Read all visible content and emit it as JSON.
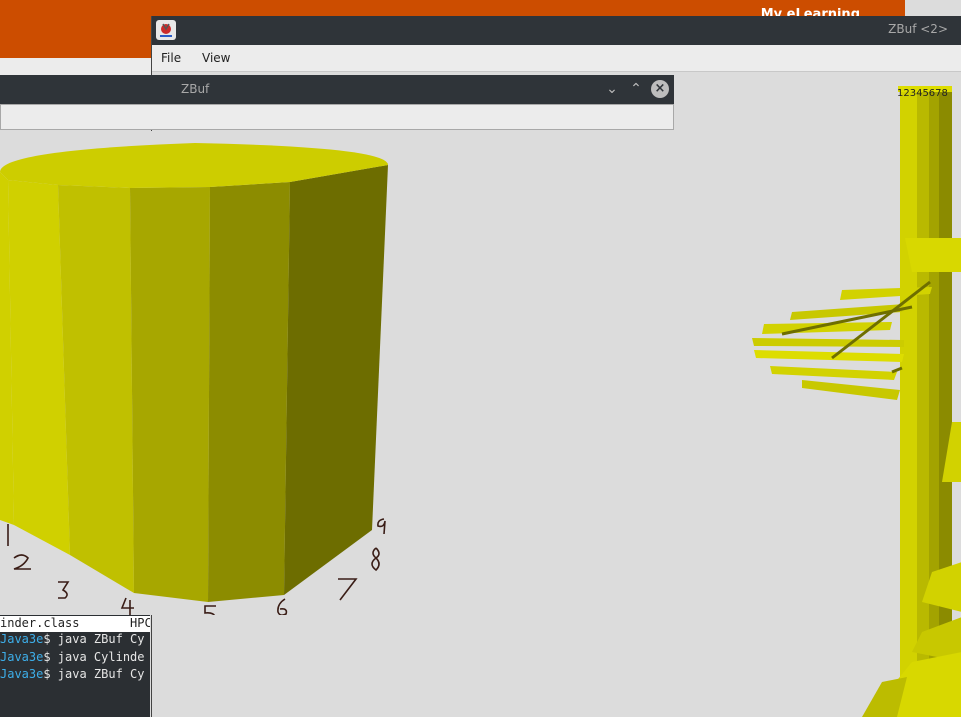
{
  "background_browser": {
    "title": "My eLearning",
    "accent": "#cc4d00"
  },
  "back_window": {
    "title": "ZBuf <2>",
    "app_icon": "java-icon",
    "menu": [
      "File",
      "View"
    ],
    "tower_labels": "12345678"
  },
  "front_window": {
    "title": "ZBuf",
    "buttons": [
      "minimize-icon",
      "maximize-icon",
      "close-icon"
    ],
    "annotations": [
      "1",
      "2",
      "3",
      "4",
      "5",
      "6",
      "7",
      "8",
      "9"
    ]
  },
  "terminal": {
    "lines": [
      {
        "text": "inder.class       HPC"
      },
      {
        "prompt": "Java3e",
        "command": "$ java ZBuf Cy"
      },
      {
        "prompt": "Java3e",
        "command": "$ java Cylinde"
      },
      {
        "prompt": "Java3e",
        "command": "$ java ZBuf Cy"
      }
    ]
  },
  "colors": {
    "cylinder": "#d2d200",
    "titlebar": "#2f3439",
    "terminal_prompt": "#3daee9"
  }
}
